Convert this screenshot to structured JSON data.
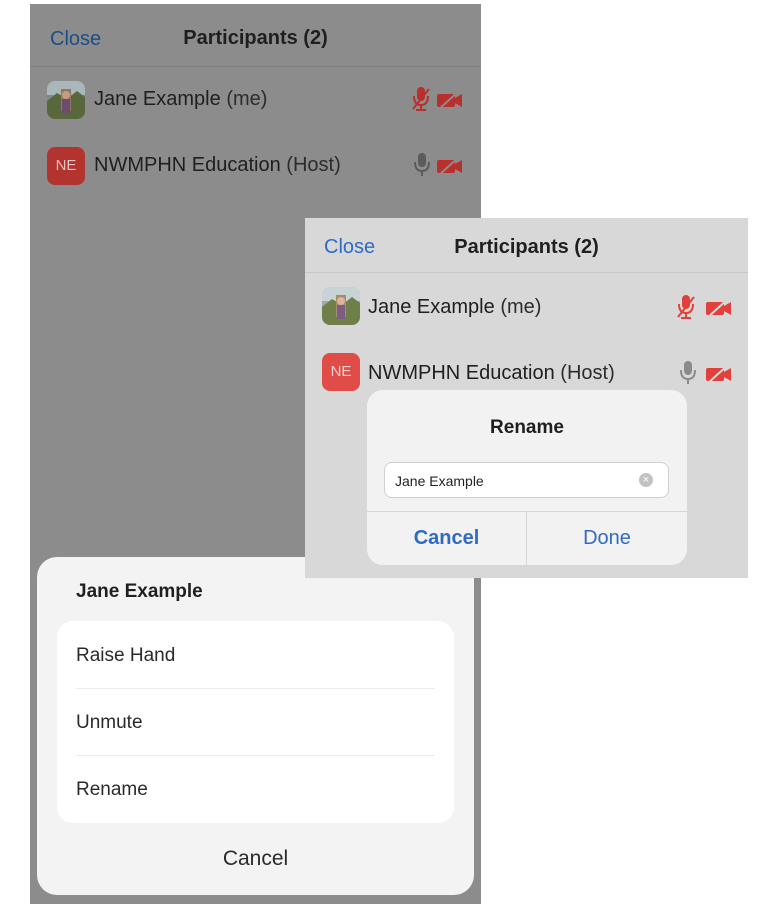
{
  "panel_back": {
    "header": {
      "close_label": "Close",
      "title": "Participants (2)"
    },
    "participants": [
      {
        "name": "Jane Example",
        "suffix": "(me)",
        "avatar": "photo",
        "mic": "mic-muted-icon",
        "video": "video-off-icon"
      },
      {
        "name": "NWMPHN Education",
        "suffix": "(Host)",
        "avatar_initials": "NE",
        "mic": "mic-on-icon",
        "video": "video-off-icon"
      }
    ]
  },
  "action_sheet": {
    "title": "Jane Example",
    "options": [
      "Raise Hand",
      "Unmute",
      "Rename"
    ],
    "cancel_label": "Cancel"
  },
  "panel_front": {
    "header": {
      "close_label": "Close",
      "title": "Participants (2)"
    },
    "participants": [
      {
        "name": "Jane Example",
        "suffix": "(me)",
        "avatar": "photo",
        "mic": "mic-muted-icon",
        "video": "video-off-icon"
      },
      {
        "name": "NWMPHN Education",
        "suffix": "(Host)",
        "avatar_initials": "NE",
        "mic": "mic-on-icon",
        "video": "video-off-icon"
      }
    ],
    "rename_dialog": {
      "title": "Rename",
      "input_value": "Jane Example",
      "cancel_label": "Cancel",
      "done_label": "Done"
    }
  },
  "colors": {
    "accent_blue": "#2f6bc4",
    "icon_red": "#d9332e",
    "host_avatar": "#b3332f"
  }
}
